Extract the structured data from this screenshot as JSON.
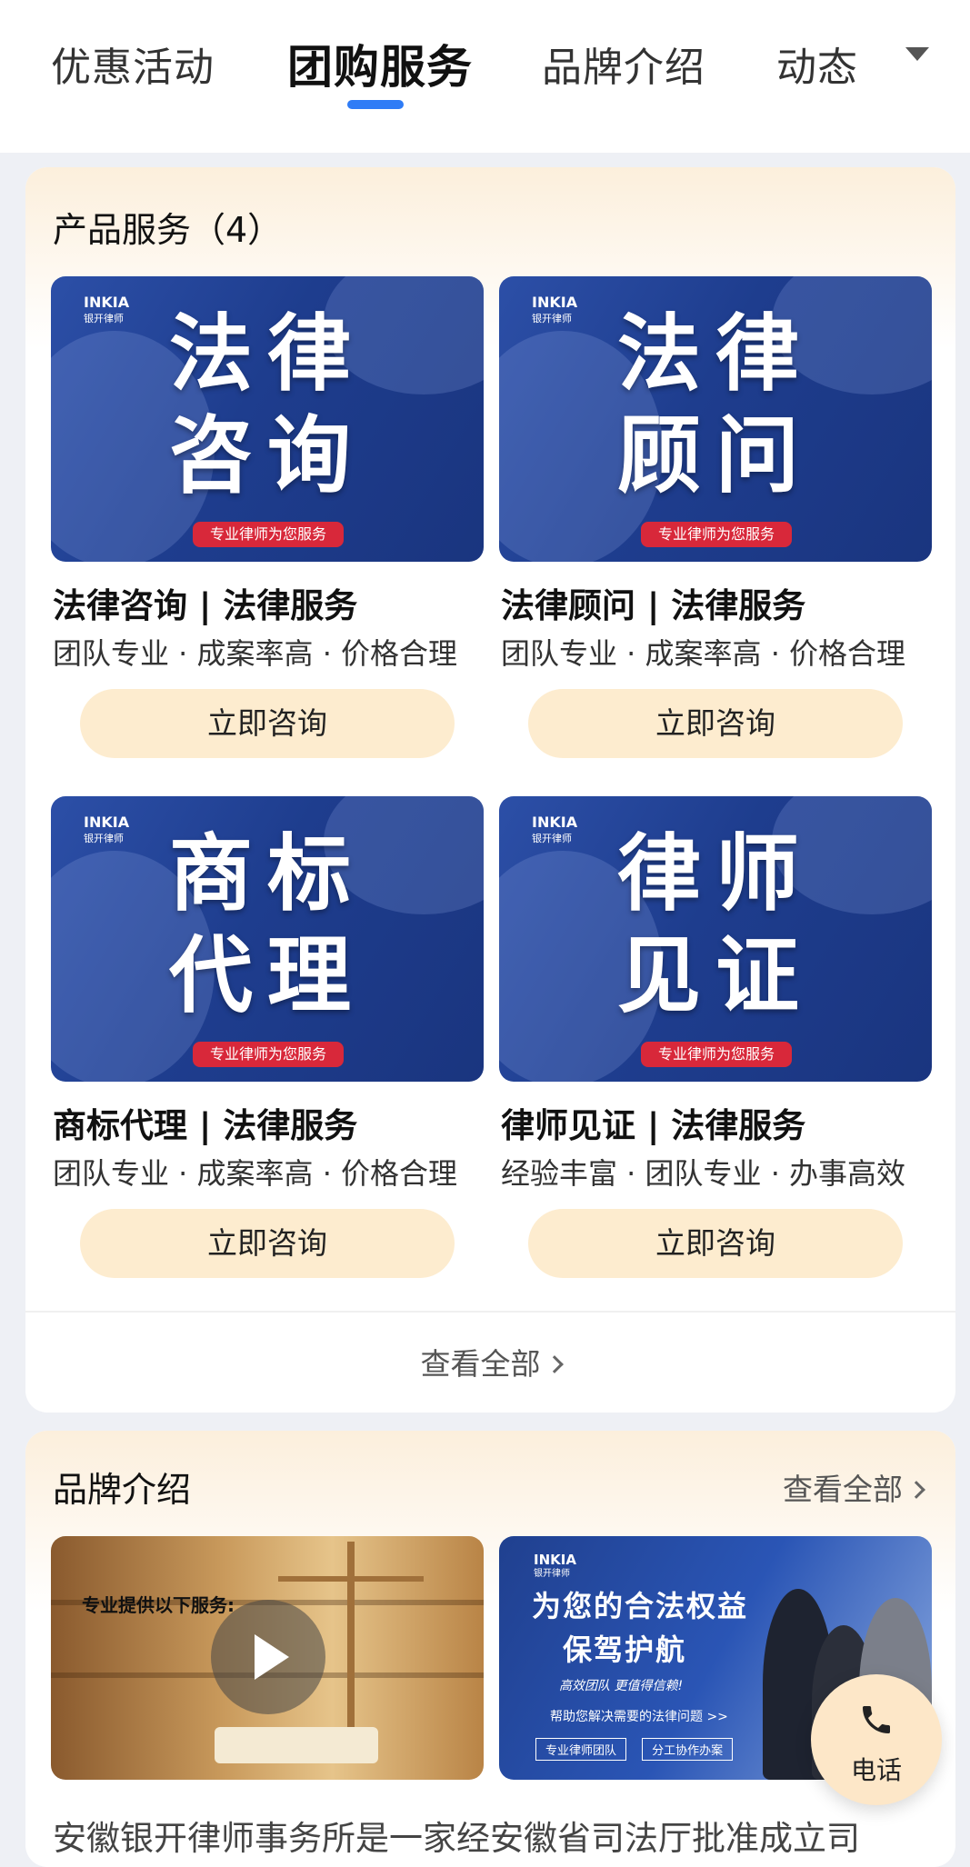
{
  "tabs": [
    {
      "label": "优惠活动"
    },
    {
      "label": "团购服务"
    },
    {
      "label": "品牌介绍"
    },
    {
      "label": "动态"
    }
  ],
  "products": {
    "title": "产品服务（4）",
    "banner_tag": "专业律师为您服务",
    "logo": {
      "name": "INKIA",
      "sub": "银开律师"
    },
    "items": [
      {
        "banner_line1": "法律",
        "banner_line2": "咨询",
        "name": "法律咨询 | 法律服务",
        "desc": "团队专业 · 成案率高 · 价格合理",
        "button": "立即咨询"
      },
      {
        "banner_line1": "法律",
        "banner_line2": "顾问",
        "name": "法律顾问 | 法律服务",
        "desc": "团队专业 · 成案率高 · 价格合理",
        "button": "立即咨询"
      },
      {
        "banner_line1": "商标",
        "banner_line2": "代理",
        "name": "商标代理 | 法律服务",
        "desc": "团队专业 · 成案率高 · 价格合理",
        "button": "立即咨询"
      },
      {
        "banner_line1": "律师",
        "banner_line2": "见证",
        "name": "律师见证 | 法律服务",
        "desc": "经验丰富 · 团队专业 · 办事高效",
        "button": "立即咨询"
      }
    ],
    "view_all": "查看全部"
  },
  "brand": {
    "title": "品牌介绍",
    "view_all": "查看全部",
    "video_caption": "专业提供以下服务:",
    "promo": {
      "logo": "INKIA",
      "logo_sub": "银开律师",
      "headline1": "为您的合法权益",
      "headline2": "保驾护航",
      "slogan": "高效团队  更值得信赖!",
      "line": "帮助您解决需要的法律问题 >>",
      "tags": [
        "专业律师团队",
        "分工协作办案"
      ]
    },
    "description": "安徽银开律师事务所是一家经安徽省司法厅批准成立司"
  },
  "fab": {
    "label": "电话",
    "icon": "phone-icon"
  },
  "colors": {
    "accent": "#2f7cf6",
    "button_bg": "#fdeccf",
    "banner_blue": "#1e3d8e",
    "tag_red": "#d8283a"
  }
}
